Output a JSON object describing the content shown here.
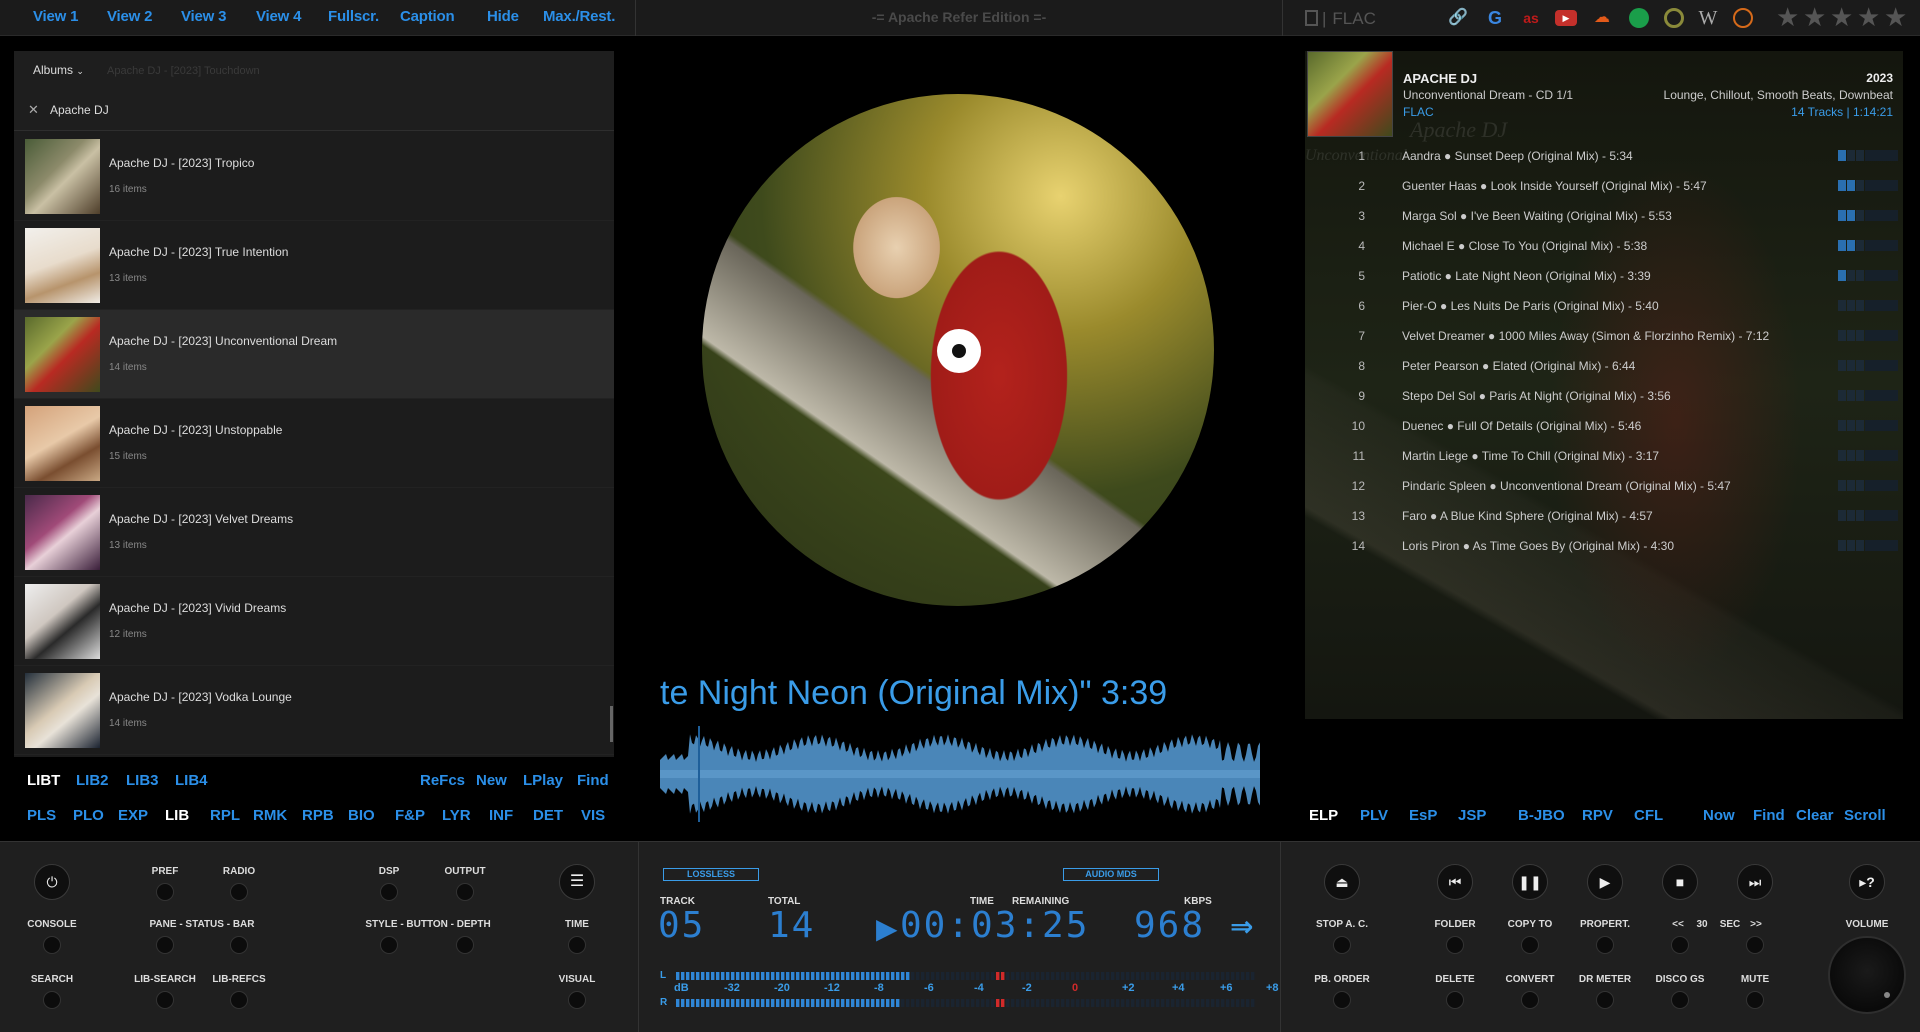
{
  "top_bar": {
    "view_menu": [
      {
        "label": "View 1",
        "active": true
      },
      {
        "label": "View 2",
        "active": false
      },
      {
        "label": "View 3",
        "active": false
      },
      {
        "label": "View 4",
        "active": false
      },
      {
        "label": "Fullscr.",
        "active": false
      },
      {
        "label": "Caption",
        "active": false
      },
      {
        "label": "Hide",
        "active": false
      },
      {
        "label": "Max./Rest.",
        "active": false
      }
    ],
    "edition_title": "-= Apache Refer Edition =-",
    "codec_label": "FLAC",
    "service_icons": [
      "link-icon",
      "google-icon",
      "lastfm-icon",
      "youtube-icon",
      "soundcloud-icon",
      "spotify-icon",
      "musicbrainz-icon",
      "wikipedia-icon",
      "podcast-icon"
    ],
    "rating_stars": 5,
    "accent_color": "#2b8fe8"
  },
  "library": {
    "ghost_text": "Apache DJ - [2023] Touchdown",
    "view_dropdown": "Albums",
    "filter_value": "Apache DJ",
    "albums": [
      {
        "title": "Apache DJ - [2023] Tropico",
        "count": "16 items",
        "selected": false
      },
      {
        "title": "Apache DJ - [2023] True Intention",
        "count": "13 items",
        "selected": false
      },
      {
        "title": "Apache DJ - [2023] Unconventional Dream",
        "count": "14 items",
        "selected": true
      },
      {
        "title": "Apache DJ - [2023] Unstoppable",
        "count": "15 items",
        "selected": false
      },
      {
        "title": "Apache DJ - [2023] Velvet Dreams",
        "count": "13 items",
        "selected": false
      },
      {
        "title": "Apache DJ - [2023] Vivid Dreams",
        "count": "12 items",
        "selected": false
      },
      {
        "title": "Apache DJ - [2023] Vodka Lounge",
        "count": "14 items",
        "selected": false
      }
    ],
    "lib_tabs": [
      {
        "label": "LIBT",
        "active": true
      },
      {
        "label": "LIB2",
        "active": false
      },
      {
        "label": "LIB3",
        "active": false
      },
      {
        "label": "LIB4",
        "active": false
      }
    ],
    "lib_actions": [
      "ReFcs",
      "New",
      "LPlay",
      "Find"
    ],
    "panel_tabs": [
      {
        "label": "PLS",
        "active": false
      },
      {
        "label": "PLO",
        "active": false
      },
      {
        "label": "EXP",
        "active": false
      },
      {
        "label": "LIB",
        "active": true
      },
      {
        "label": "RPL",
        "active": false
      },
      {
        "label": "RMK",
        "active": false
      },
      {
        "label": "RPB",
        "active": false
      },
      {
        "label": "BIO",
        "active": false
      },
      {
        "label": "F&P",
        "active": false
      },
      {
        "label": "LYR",
        "active": false
      },
      {
        "label": "INF",
        "active": false
      },
      {
        "label": "DET",
        "active": false
      },
      {
        "label": "VIS",
        "active": false
      }
    ]
  },
  "now_playing": {
    "scroll_text": "te Night Neon (Original Mix)\" 3:39"
  },
  "playlist": {
    "artist": "APACHE DJ",
    "album": "Unconventional Dream - CD 1/1",
    "codec": "FLAC",
    "year": "2023",
    "genre": "Lounge, Chillout, Smooth Beats, Downbeat",
    "meta": "14 Tracks | 1:14:21",
    "ghost_artist": "Apache DJ",
    "ghost_album": "Unconventional",
    "tracks": [
      {
        "num": "1",
        "text": "Aandra ● Sunset Deep (Original Mix) - 5:34",
        "rating": 1
      },
      {
        "num": "2",
        "text": "Guenter Haas ● Look Inside Yourself (Original Mix) - 5:47",
        "rating": 2
      },
      {
        "num": "3",
        "text": "Marga Sol ● I've Been Waiting (Original Mix) - 5:53",
        "rating": 2
      },
      {
        "num": "4",
        "text": "Michael E ● Close To You (Original Mix) - 5:38",
        "rating": 2
      },
      {
        "num": "5",
        "text": "Patiotic ● Late Night Neon (Original Mix) - 3:39",
        "rating": 1
      },
      {
        "num": "6",
        "text": "Pier-O ● Les Nuits De Paris (Original Mix) - 5:40",
        "rating": 0
      },
      {
        "num": "7",
        "text": "Velvet Dreamer ● 1000 Miles Away (Simon & Florzinho Remix) - 7:12",
        "rating": 0
      },
      {
        "num": "8",
        "text": "Peter Pearson ● Elated (Original Mix) - 6:44",
        "rating": 0
      },
      {
        "num": "9",
        "text": "Stepo Del Sol ● Paris At Night (Original Mix) - 3:56",
        "rating": 0
      },
      {
        "num": "10",
        "text": "Duenec ● Full Of Details (Original Mix) - 5:46",
        "rating": 0
      },
      {
        "num": "11",
        "text": "Martin Liege ● Time To Chill (Original Mix) - 3:17",
        "rating": 0
      },
      {
        "num": "12",
        "text": "Pindaric Spleen ● Unconventional Dream (Original Mix) - 5:47",
        "rating": 0
      },
      {
        "num": "13",
        "text": "Faro ● A Blue Kind Sphere (Original Mix) - 4:57",
        "rating": 0
      },
      {
        "num": "14",
        "text": "Loris Piron ● As Time Goes By (Original Mix) - 4:30",
        "rating": 0
      }
    ],
    "tabs": [
      {
        "label": "ELP",
        "active": true
      },
      {
        "label": "PLV",
        "active": false
      },
      {
        "label": "EsP",
        "active": false
      },
      {
        "label": "JSP",
        "active": false
      },
      {
        "label": "B-JBO",
        "active": false
      },
      {
        "label": "RPV",
        "active": false
      },
      {
        "label": "CFL",
        "active": false
      }
    ],
    "actions": [
      "Now",
      "Find",
      "Clear",
      "Scroll"
    ]
  },
  "deck": {
    "left": {
      "pref": "PREF",
      "radio": "RADIO",
      "dsp": "DSP",
      "output": "OUTPUT",
      "console": "CONSOLE",
      "pane_status_bar": "PANE - STATUS - BAR",
      "style_button_depth": "STYLE - BUTTON - DEPTH",
      "time": "TIME",
      "search": "SEARCH",
      "lib_search": "LIB-SEARCH",
      "lib_refcs": "LIB-REFCS",
      "visual": "VISUAL"
    },
    "lcd": {
      "lossless": "LOSSLESS",
      "audio_mds": "AUDIO MDS",
      "track_label": "TRACK",
      "total_label": "TOTAL",
      "time_label": "TIME",
      "remaining_label": "REMAINING",
      "kbps_label": "KBPS",
      "track": "05",
      "total": "14",
      "time": "00:03:25",
      "kbps": "968",
      "vu_l": "L",
      "vu_r": "R",
      "vu_scale": [
        "dB",
        "-32",
        "-20",
        "-12",
        "-8",
        "-6",
        "-4",
        "-2",
        "0",
        "+2",
        "+4",
        "+6",
        "+8"
      ]
    },
    "right": {
      "stop_ac": "STOP A. C.",
      "folder": "FOLDER",
      "copy_to": "COPY TO",
      "propert": "PROPERT.",
      "seek_back": "<<",
      "seek_value": "30",
      "seek_unit": "SEC",
      "seek_fwd": ">>",
      "volume": "VOLUME",
      "pb_order": "PB. ORDER",
      "delete": "DELETE",
      "convert": "CONVERT",
      "dr_meter": "DR METER",
      "disco_gs": "DISCO GS",
      "mute": "MUTE"
    }
  }
}
